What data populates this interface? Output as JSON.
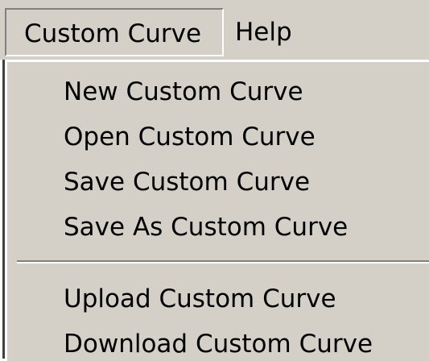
{
  "menubar": {
    "items": [
      {
        "label": "Custom Curve"
      },
      {
        "label": "Help"
      }
    ]
  },
  "dropdown": {
    "group1": [
      {
        "label": "New Custom Curve"
      },
      {
        "label": "Open Custom Curve"
      },
      {
        "label": "Save Custom Curve"
      },
      {
        "label": "Save As Custom Curve"
      }
    ],
    "group2": [
      {
        "label": "Upload Custom Curve"
      },
      {
        "label": "Download Custom Curve"
      }
    ]
  },
  "colors": {
    "menu_background": "#d4d0c8",
    "highlight": "#ffffff",
    "shadow": "#808080",
    "text": "#000000"
  }
}
